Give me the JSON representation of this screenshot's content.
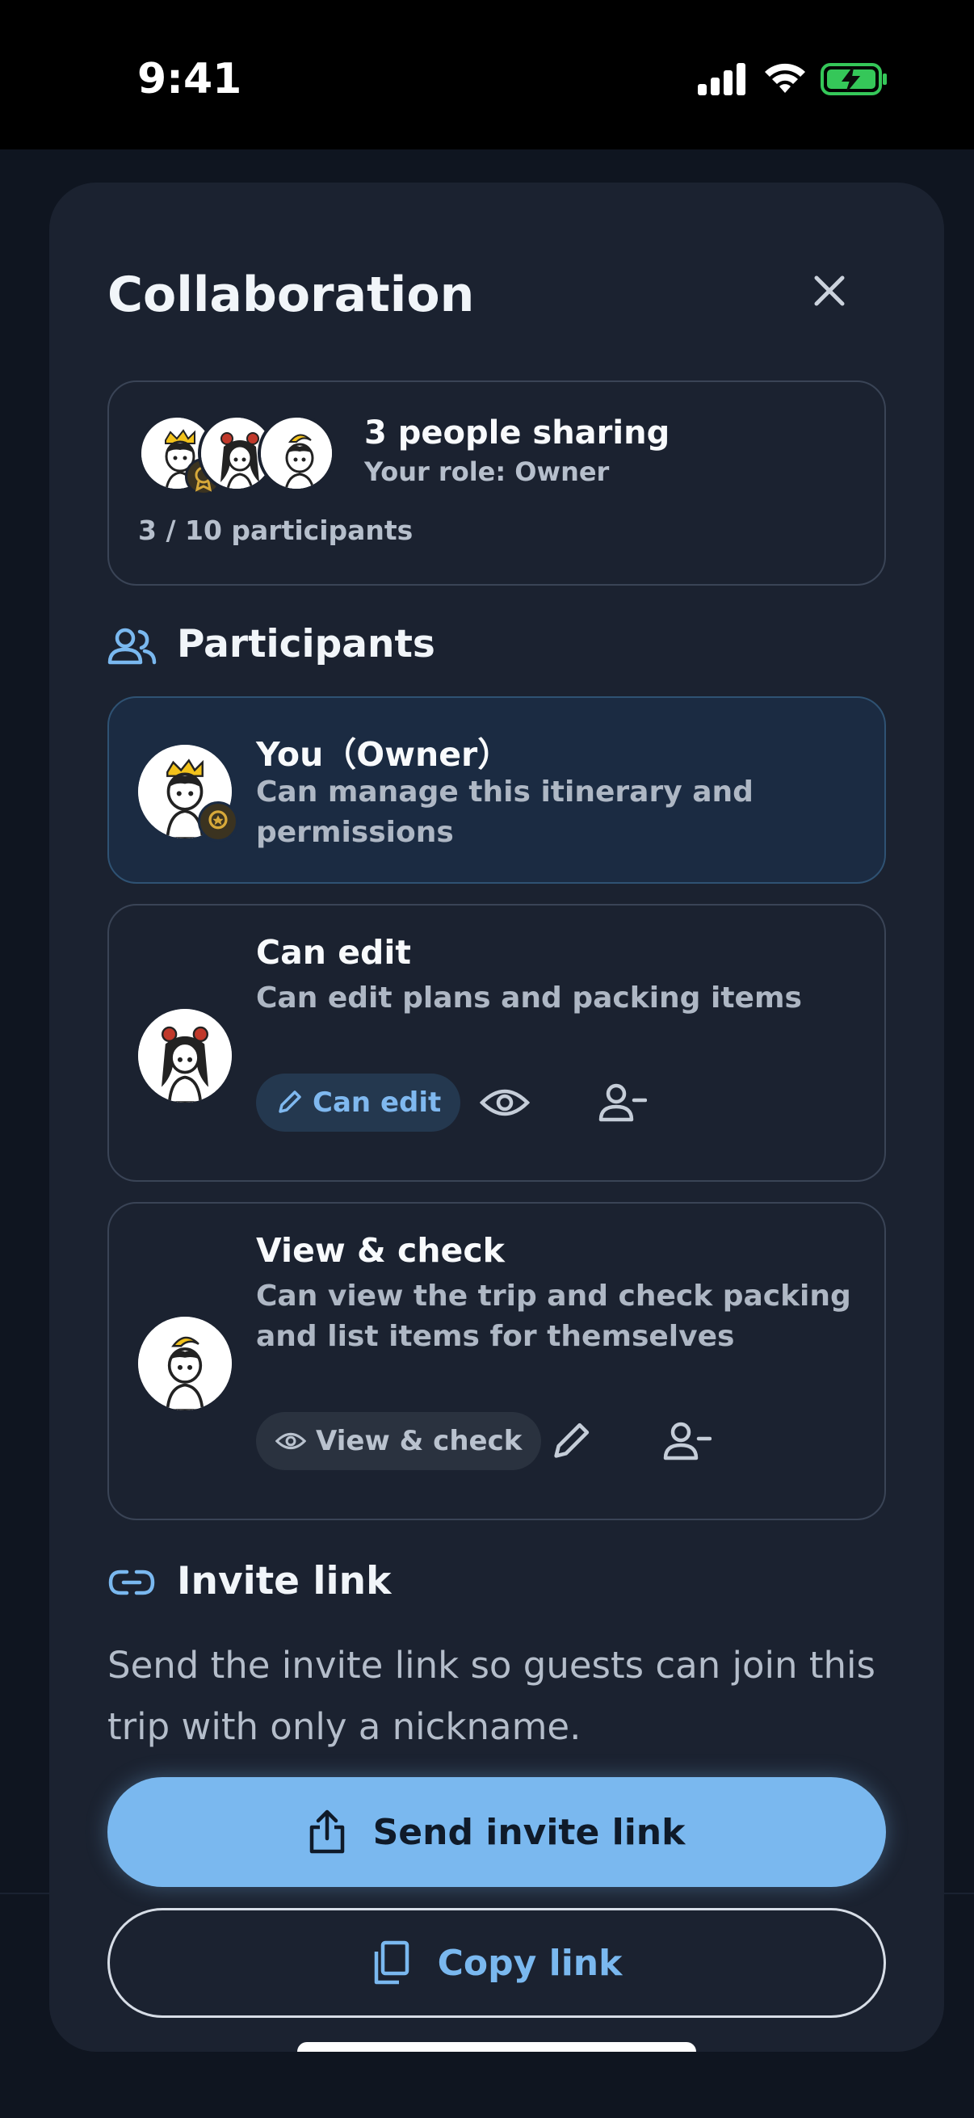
{
  "status_bar": {
    "time": "9:41"
  },
  "sheet": {
    "title": "Collaboration"
  },
  "summary": {
    "headline": "3 people sharing",
    "role": "Your role: Owner",
    "count": "3 / 10 participants"
  },
  "participants_section": {
    "title": "Participants"
  },
  "participants": [
    {
      "title": "You（Owner）",
      "description": "Can manage this itinerary and permissions"
    },
    {
      "title": "Can edit",
      "description": "Can edit plans and packing items",
      "role_chip": "Can edit"
    },
    {
      "title": "View & check",
      "description": "Can view the trip and check packing and list items for themselves",
      "role_chip": "View & check"
    }
  ],
  "invite_section": {
    "title": "Invite link",
    "description": "Send the invite link so guests can join this trip with only a nickname.",
    "send_label": "Send invite link",
    "copy_label": "Copy link"
  },
  "colors": {
    "accent": "#7ab8ef",
    "sheet_bg": "#1b2230",
    "active_card_bg": "#1b2b42",
    "battery_green": "#35c759"
  }
}
